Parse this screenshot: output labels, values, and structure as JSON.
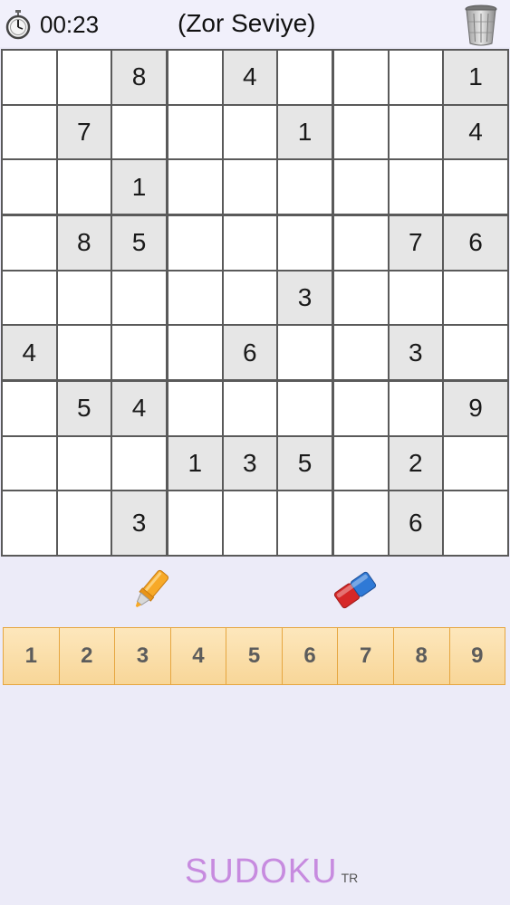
{
  "header": {
    "timer": "00:23",
    "level": "(Zor Seviye)",
    "timer_icon": "stopwatch-icon",
    "trash_icon": "trash-can-icon"
  },
  "board": {
    "rows": [
      [
        "",
        "",
        "8",
        "",
        "4",
        "",
        "",
        "",
        "1"
      ],
      [
        "",
        "7",
        "",
        "",
        "",
        "1",
        "",
        "",
        "4"
      ],
      [
        "",
        "",
        "1",
        "",
        "",
        "",
        "",
        "",
        ""
      ],
      [
        "",
        "8",
        "5",
        "",
        "",
        "",
        "",
        "7",
        "6"
      ],
      [
        "",
        "",
        "",
        "",
        "",
        "3",
        "",
        "",
        ""
      ],
      [
        "4",
        "",
        "",
        "",
        "6",
        "",
        "",
        "3",
        ""
      ],
      [
        "",
        "5",
        "4",
        "",
        "",
        "",
        "",
        "",
        "9"
      ],
      [
        "",
        "",
        "",
        "1",
        "3",
        "5",
        "",
        "2",
        ""
      ],
      [
        "",
        "",
        "3",
        "",
        "",
        "",
        "",
        "6",
        ""
      ]
    ]
  },
  "tools": {
    "pencil_icon": "highlighter-pen-icon",
    "eraser_icon": "eraser-icon"
  },
  "numpad": {
    "keys": [
      "1",
      "2",
      "3",
      "4",
      "5",
      "6",
      "7",
      "8",
      "9"
    ]
  },
  "branding": {
    "name": "SUDOKU",
    "suffix": "TR"
  },
  "colors": {
    "given_cell": "#e6e6e6",
    "empty_cell": "#ffffff",
    "numpad_fill": "#fbdfa9",
    "numpad_border": "#e6a640",
    "brand": "#c78bdf",
    "background": "#ecebf8"
  }
}
